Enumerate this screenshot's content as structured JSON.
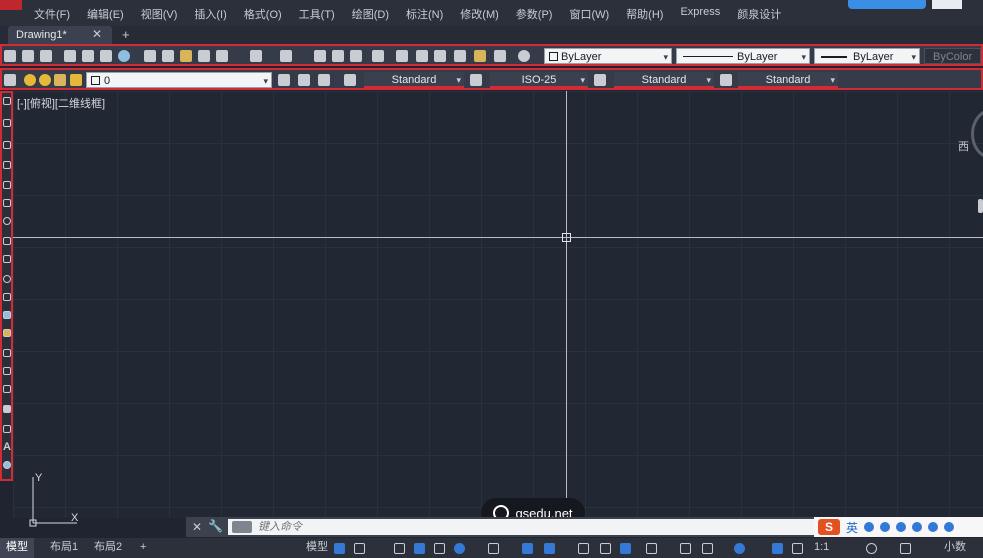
{
  "menu": {
    "items": [
      "文件(F)",
      "编辑(E)",
      "视图(V)",
      "插入(I)",
      "格式(O)",
      "工具(T)",
      "绘图(D)",
      "标注(N)",
      "修改(M)",
      "参数(P)",
      "窗口(W)",
      "帮助(H)",
      "Express",
      "颜泉设计"
    ]
  },
  "tabs": {
    "document": "Drawing1*",
    "close_glyph": "✕",
    "add_glyph": "+"
  },
  "toolbar1": {
    "color_combo": "ByLayer",
    "linetype_combo": "ByLayer",
    "lineweight_combo": "ByLayer",
    "plotstyle_combo": "ByColor"
  },
  "toolbar2": {
    "layer_combo": "0",
    "text_style": "Standard",
    "dim_style": "ISO-25",
    "table_style": "Standard",
    "multileader_style": "Standard"
  },
  "viewport": {
    "label": "[-][俯视][二维线框]",
    "compass_west": "西",
    "ucs_x": "X",
    "ucs_y": "Y"
  },
  "watermark": {
    "text": "qsedu.net"
  },
  "command": {
    "close_glyph": "✕",
    "placeholder": "键入命令"
  },
  "ime": {
    "logo": "S",
    "lang": "英"
  },
  "status": {
    "tabs": [
      "模型",
      "布局1",
      "布局2"
    ],
    "add_glyph": "+",
    "model_button": "模型",
    "scale": "1:1",
    "units": "小数"
  },
  "colors": {
    "highlight_border": "#d12c36",
    "accent_blue": "#3479d6"
  }
}
